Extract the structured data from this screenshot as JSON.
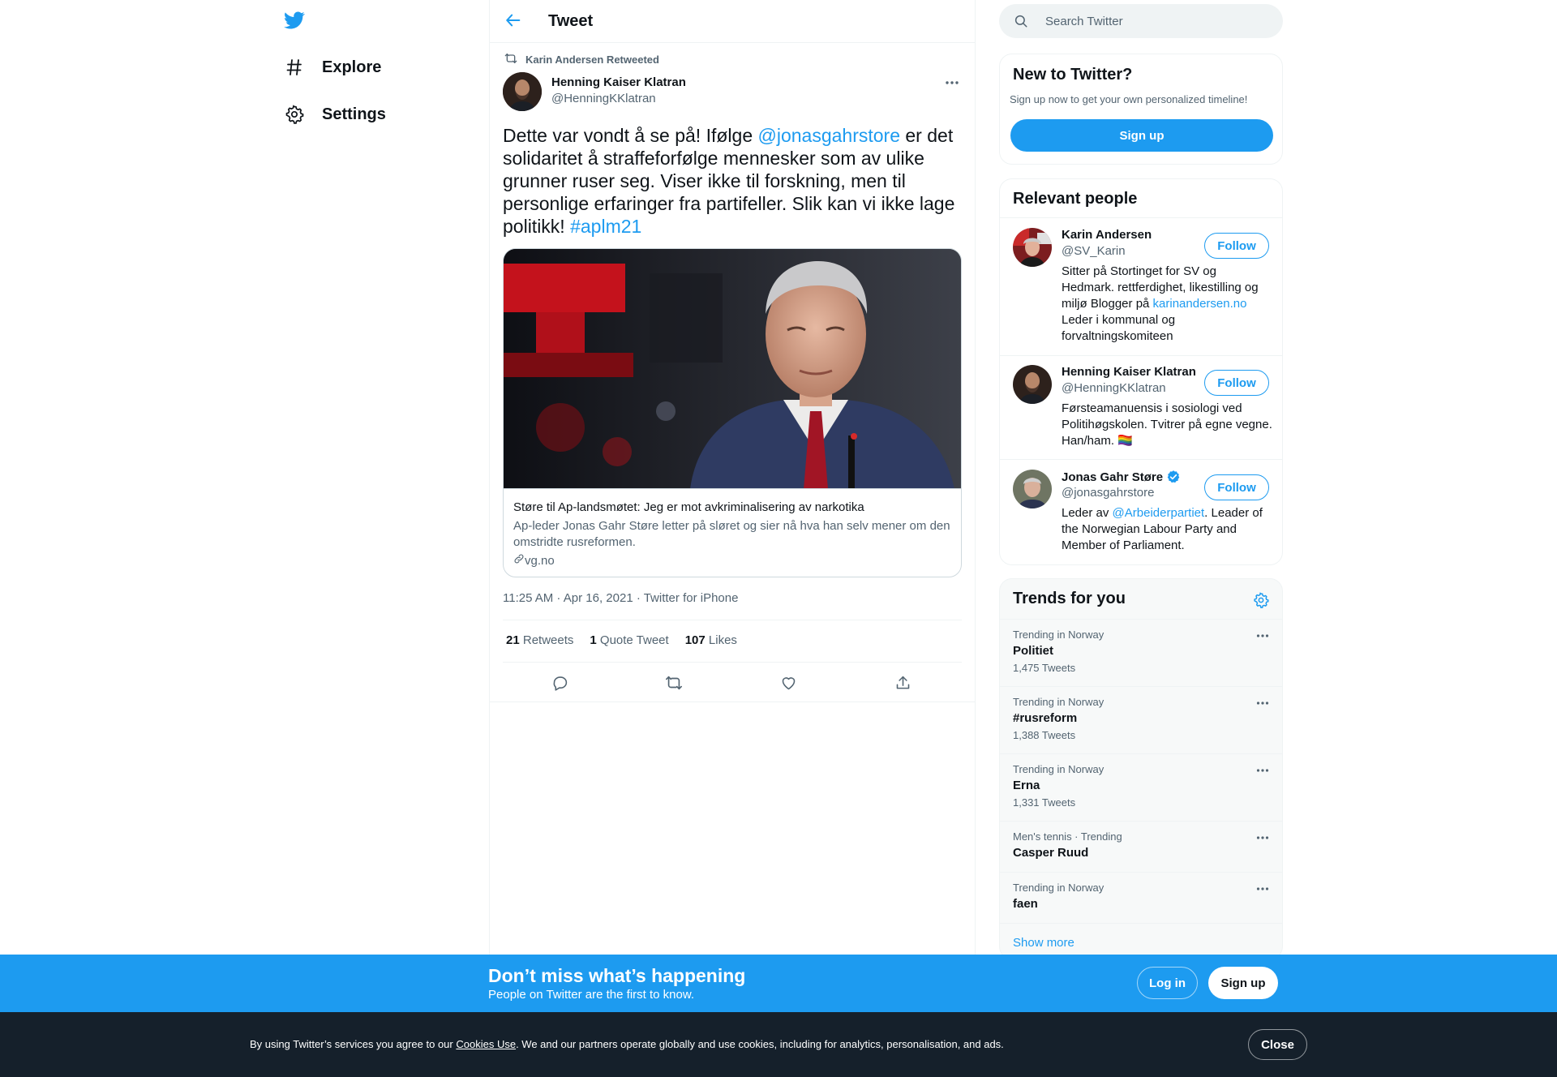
{
  "nav": {
    "items": [
      {
        "label": "Explore",
        "icon": "hashtag-icon"
      },
      {
        "label": "Settings",
        "icon": "gear-icon"
      }
    ]
  },
  "header": {
    "title": "Tweet"
  },
  "tweet": {
    "retweeted_by": "Karin Andersen Retweeted",
    "author_name": "Henning Kaiser Klatran",
    "author_handle": "@HenningKKlatran",
    "text_parts": {
      "t1": "Dette var vondt å se på! Ifølge ",
      "mention": "@jonasgahrstore",
      "t2": " er det solidaritet å straffeforfølge mennesker som av ulike grunner ruser seg. Viser ikke til forskning, men til personlige erfaringer fra partifeller. Slik kan vi ikke lage politikk! ",
      "hashtag": "#aplm21"
    },
    "card": {
      "title": "Støre til Ap-landsmøtet: Jeg er mot avkriminalisering av narkotika",
      "description": "Ap-leder Jonas Gahr Støre letter på sløret og sier nå hva han selv mener om den omstridte rusreformen.",
      "domain": "vg.no"
    },
    "meta": "11:25 AM · Apr 16, 2021 · Twitter for iPhone",
    "stats": {
      "retweets_count": "21",
      "retweets_label": "Retweets",
      "quotes_count": "1",
      "quotes_label": "Quote Tweet",
      "likes_count": "107",
      "likes_label": "Likes"
    }
  },
  "search": {
    "placeholder": "Search Twitter"
  },
  "new_to_twitter": {
    "title": "New to Twitter?",
    "subtitle": "Sign up now to get your own personalized timeline!",
    "button": "Sign up"
  },
  "relevant_people": {
    "title": "Relevant people",
    "follow_label": "Follow",
    "people": [
      {
        "name": "Karin Andersen",
        "handle": "@SV_Karin",
        "bio_1": "Sitter på Stortinget for SV og Hedmark. rettferdighet, likestilling og miljø Blogger på ",
        "bio_link": "karinandersen.no",
        "bio_2": " Leder i kommunal og forvaltningskomiteen"
      },
      {
        "name": "Henning Kaiser Klatran",
        "handle": "@HenningKKlatran",
        "bio_1": "Førsteamanuensis i sosiologi ved Politihøgskolen. Tvitrer på egne vegne. Han/ham. 🏳️‍🌈"
      },
      {
        "name": "Jonas Gahr Støre",
        "handle": "@jonasgahrstore",
        "verified": true,
        "bio_1": "Leder av ",
        "bio_link": "@Arbeiderpartiet",
        "bio_2": ". Leader of the Norwegian Labour Party and Member of Parliament."
      }
    ]
  },
  "trends": {
    "title": "Trends for you",
    "items": [
      {
        "context": "Trending in Norway",
        "name": "Politiet",
        "count": "1,475 Tweets"
      },
      {
        "context": "Trending in Norway",
        "name": "#rusreform",
        "count": "1,388 Tweets"
      },
      {
        "context": "Trending in Norway",
        "name": "Erna",
        "count": "1,331 Tweets"
      },
      {
        "context": "Men's tennis · Trending",
        "name": "Casper Ruud",
        "count": ""
      },
      {
        "context": "Trending in Norway",
        "name": "faen",
        "count": ""
      }
    ],
    "show_more": "Show more"
  },
  "bottom_bar": {
    "title": "Don’t miss what’s happening",
    "subtitle": "People on Twitter are the first to know.",
    "login": "Log in",
    "signup": "Sign up"
  },
  "cookie": {
    "prefix": "By using Twitter’s services you agree to our ",
    "link": "Cookies Use",
    "suffix": ". We and our partners operate globally and use cookies, including for analytics, personalisation, and ads.",
    "close": "Close"
  },
  "colors": {
    "accent": "#1d9bf0",
    "text": "#0f1419",
    "muted": "#536471",
    "cookie_bg": "#15202b"
  }
}
